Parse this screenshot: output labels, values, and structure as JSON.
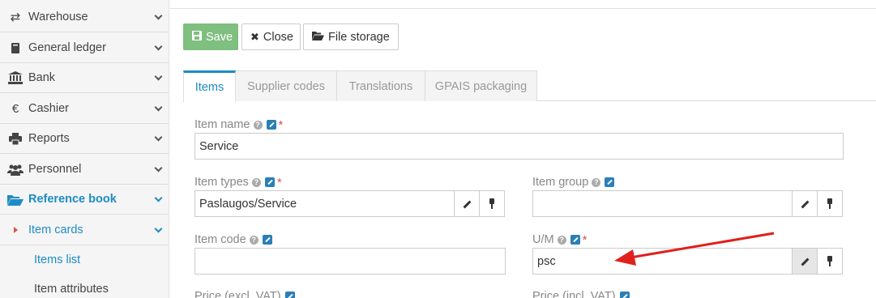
{
  "sidebar": {
    "items": [
      {
        "label": "Warehouse",
        "icon": "transfer-icon"
      },
      {
        "label": "General ledger",
        "icon": "book-icon"
      },
      {
        "label": "Bank",
        "icon": "bank-icon"
      },
      {
        "label": "Cashier",
        "icon": "euro-icon"
      },
      {
        "label": "Reports",
        "icon": "print-icon"
      },
      {
        "label": "Personnel",
        "icon": "users-icon"
      },
      {
        "label": "Reference book",
        "icon": "folder-open-icon"
      }
    ],
    "submenu": {
      "label": "Item cards"
    },
    "leaves": [
      {
        "label": "Items list"
      },
      {
        "label": "Item attributes"
      }
    ]
  },
  "toolbar": {
    "save_label": "Save",
    "close_label": "Close",
    "file_storage_label": "File storage"
  },
  "tabs": [
    {
      "label": "Items"
    },
    {
      "label": "Supplier codes"
    },
    {
      "label": "Translations"
    },
    {
      "label": "GPAIS packaging"
    }
  ],
  "form": {
    "item_name": {
      "label": "Item name",
      "value": "Service"
    },
    "item_types": {
      "label": "Item types",
      "value": "Paslaugos/Service"
    },
    "item_group": {
      "label": "Item group",
      "value": ""
    },
    "item_code": {
      "label": "Item code",
      "value": ""
    },
    "um": {
      "label": "U/M",
      "value": "psc"
    },
    "price_excl": {
      "label": "Price (excl. VAT)"
    },
    "price_incl": {
      "label": "Price (incl. VAT)"
    }
  },
  "colors": {
    "accent": "#1d8cc4",
    "save": "#7fbf7f",
    "required": "#d9534f",
    "annotation_arrow": "#e0201c"
  }
}
